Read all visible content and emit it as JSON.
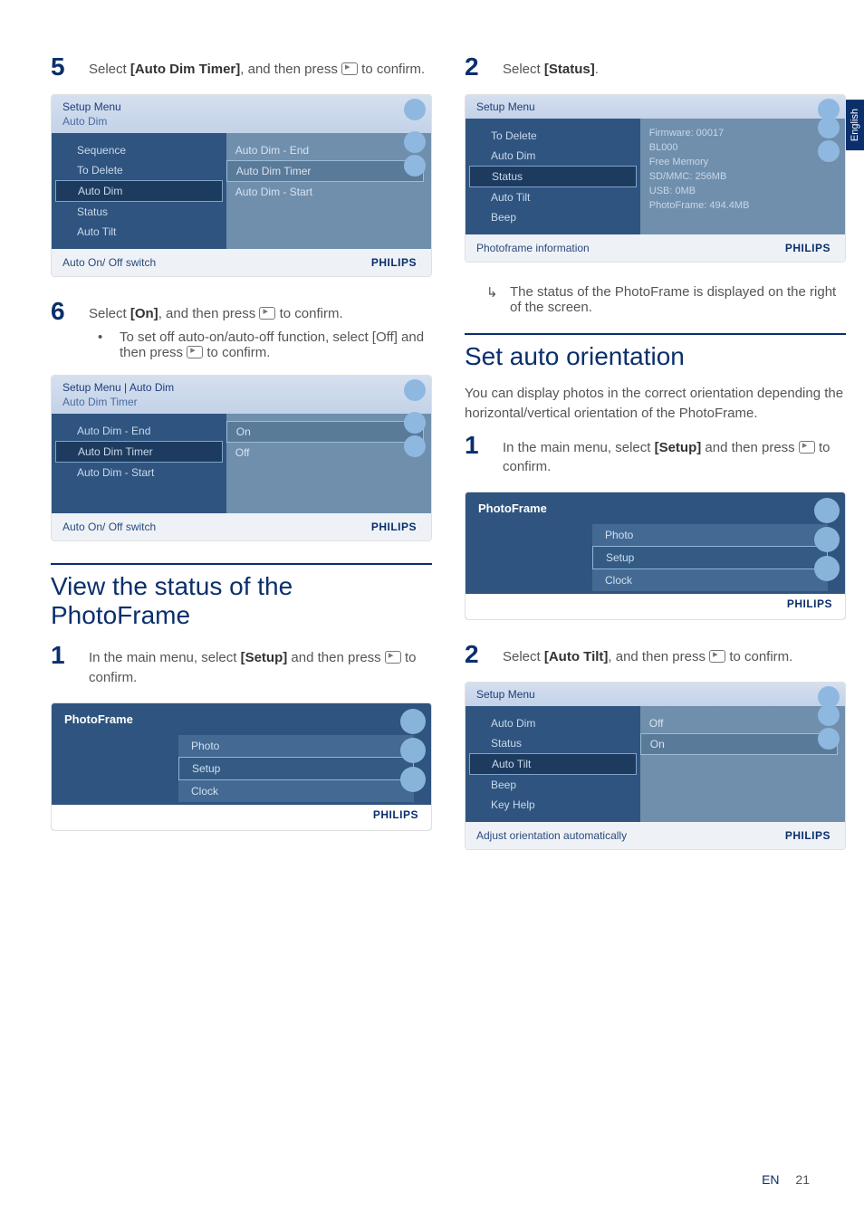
{
  "lang_tab": "English",
  "left": {
    "step5": {
      "num": "5",
      "pre": "Select ",
      "bold": "[Auto Dim Timer]",
      "post": ", and then press ",
      "tail": " to confirm."
    },
    "ss1": {
      "top1": "Setup Menu",
      "top2": "Auto Dim",
      "left_items": [
        "Sequence",
        "To Delete",
        "Auto Dim",
        "Status",
        "Auto Tilt"
      ],
      "left_sel": 2,
      "right_items": [
        "Auto Dim - End",
        "Auto Dim Timer",
        "Auto Dim - Start"
      ],
      "right_sel": 1,
      "bottom": "Auto On/ Off switch",
      "logo": "PHILIPS"
    },
    "step6": {
      "num": "6",
      "pre": "Select ",
      "bold": "[On]",
      "post": ", and then press ",
      "tail": " to confirm."
    },
    "bullet6": {
      "text_a": "To set off auto-on/auto-off function, select ",
      "bold": "[Off]",
      "text_b": " and then press ",
      "text_c": " to confirm."
    },
    "ss2": {
      "top1": "Setup Menu | Auto Dim",
      "top2": "Auto Dim Timer",
      "left_items": [
        "Auto Dim - End",
        "Auto Dim Timer",
        "Auto Dim - Start"
      ],
      "left_sel": 1,
      "right_items": [
        "On",
        "Off"
      ],
      "right_sel": 0,
      "bottom": "Auto On/ Off switch",
      "logo": "PHILIPS"
    },
    "heading": "View the status of the PhotoFrame",
    "step_v1": {
      "num": "1",
      "pre": "In the main menu, select ",
      "bold": "[Setup]",
      "post": " and then press ",
      "tail": " to confirm."
    },
    "ss3": {
      "title": "PhotoFrame",
      "items": [
        "Photo",
        "Setup",
        "Clock"
      ],
      "sel": 1,
      "logo": "PHILIPS"
    }
  },
  "right": {
    "step_r2a": {
      "num": "2",
      "pre": "Select ",
      "bold": "[Status]",
      "post": "."
    },
    "ss4": {
      "top1": "Setup Menu",
      "left_items": [
        "To Delete",
        "Auto Dim",
        "Status",
        "Auto Tilt",
        "Beep"
      ],
      "left_sel": 2,
      "right_info": [
        "Firmware:  00017",
        "BL000",
        "Free Memory",
        "SD/MMC:  256MB",
        "USB:  0MB",
        "PhotoFrame: 494.4MB"
      ],
      "bottom": "Photoframe information",
      "logo": "PHILIPS"
    },
    "arrow_text": "The status of the PhotoFrame is displayed on the right of the screen.",
    "heading": "Set auto orientation",
    "intro": "You can display photos in the correct orientation depending the horizontal/vertical orientation of the PhotoFrame.",
    "step_o1": {
      "num": "1",
      "pre": "In the main menu, select ",
      "bold": "[Setup]",
      "post": " and then press ",
      "tail": " to confirm."
    },
    "ss5": {
      "title": "PhotoFrame",
      "items": [
        "Photo",
        "Setup",
        "Clock"
      ],
      "sel": 1,
      "logo": "PHILIPS"
    },
    "step_o2": {
      "num": "2",
      "pre": "Select ",
      "bold": "[Auto Tilt]",
      "post": ", and then press ",
      "tail": " to confirm."
    },
    "ss6": {
      "top1": "Setup Menu",
      "left_items": [
        "Auto Dim",
        "Status",
        "Auto Tilt",
        "Beep",
        "Key Help"
      ],
      "left_sel": 2,
      "right_items": [
        "Off",
        "On"
      ],
      "right_sel": 1,
      "bottom": "Adjust orientation automatically",
      "logo": "PHILIPS"
    }
  },
  "footer": {
    "lang": "EN",
    "page": "21"
  }
}
